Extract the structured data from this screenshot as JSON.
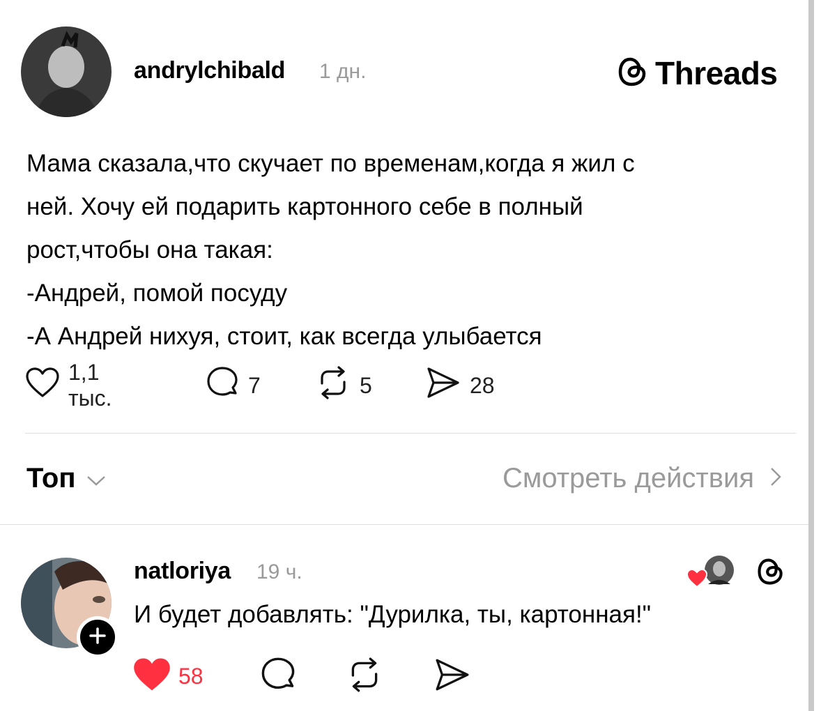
{
  "post": {
    "username": "andrylchibald",
    "time": "1 дн.",
    "brand": "Threads",
    "text_lines": [
      "Мама сказала,что скучает по временам,когда я жил с",
      "ней. Хочу ей подарить картонного себе в полный",
      "рост,чтобы она такая:",
      "-Андрей, помой посуду",
      "-А Андрей нихуя, стоит, как всегда улыбается"
    ],
    "stats": {
      "likes": "1,1 тыс.",
      "replies": "7",
      "reposts": "5",
      "shares": "28"
    }
  },
  "controls": {
    "sort_label": "Топ",
    "view_activity_label": "Смотреть действия"
  },
  "reply": {
    "username": "natloriya",
    "time": "19 ч.",
    "text": "И будет добавлять: \"Дурилка, ты, картонная!\"",
    "likes": "58",
    "like_color": "#ff3040"
  },
  "icons": [
    "threads-logo-icon",
    "heart-icon",
    "comment-icon",
    "repost-icon",
    "share-icon",
    "chevron-down-icon",
    "chevron-right-icon",
    "plus-icon"
  ]
}
